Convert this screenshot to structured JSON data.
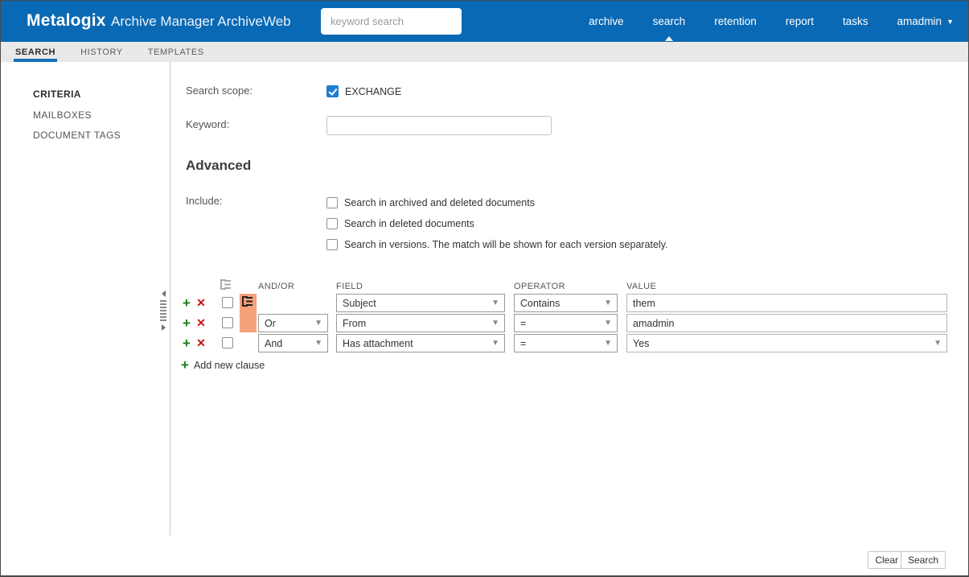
{
  "header": {
    "brand": "Metalogix",
    "app_title": "Archive Manager ArchiveWeb",
    "search_placeholder": "keyword search",
    "nav": [
      {
        "label": "archive",
        "active": false
      },
      {
        "label": "search",
        "active": true
      },
      {
        "label": "retention",
        "active": false
      },
      {
        "label": "report",
        "active": false
      },
      {
        "label": "tasks",
        "active": false
      },
      {
        "label": "amadmin",
        "active": false,
        "has_dropdown": true
      }
    ]
  },
  "tabs": [
    {
      "label": "SEARCH",
      "active": true
    },
    {
      "label": "HISTORY",
      "active": false
    },
    {
      "label": "TEMPLATES",
      "active": false
    }
  ],
  "sidebar": {
    "items": [
      {
        "label": "CRITERIA",
        "active": true
      },
      {
        "label": "MAILBOXES",
        "active": false
      },
      {
        "label": "DOCUMENT TAGS",
        "active": false
      }
    ]
  },
  "criteria": {
    "search_scope_label": "Search scope:",
    "scopes": [
      {
        "label": "EXCHANGE",
        "checked": true
      }
    ],
    "keyword_label": "Keyword:",
    "keyword_value": "",
    "advanced_title": "Advanced",
    "include_label": "Include:",
    "include_options": [
      {
        "label": "Search in archived and deleted documents",
        "checked": false
      },
      {
        "label": "Search in deleted documents",
        "checked": false
      },
      {
        "label": "Search in versions. The match will be shown for each version separately.",
        "checked": false
      }
    ],
    "clause_table": {
      "headers": {
        "andor": "AND/OR",
        "field": "FIELD",
        "operator": "OPERATOR",
        "value": "VALUE"
      },
      "rows": [
        {
          "andor": "",
          "field": "Subject",
          "operator": "Contains",
          "value": "them",
          "value_type": "text",
          "in_group": true
        },
        {
          "andor": "Or",
          "field": "From",
          "operator": "=",
          "value": "amadmin",
          "value_type": "text",
          "in_group": true
        },
        {
          "andor": "And",
          "field": "Has attachment",
          "operator": "=",
          "value": "Yes",
          "value_type": "select",
          "in_group": false
        }
      ],
      "add_clause_label": "Add new clause"
    }
  },
  "footer": {
    "clear_label": "Clear",
    "search_label": "Search"
  },
  "colors": {
    "header_blue": "#0a69b4",
    "tab_underline_blue": "#1271b6",
    "checkbox_blue": "#1b7fd3",
    "group_orange": "#f5a17a",
    "add_green": "#1e7e1e",
    "delete_red": "#c41414"
  }
}
